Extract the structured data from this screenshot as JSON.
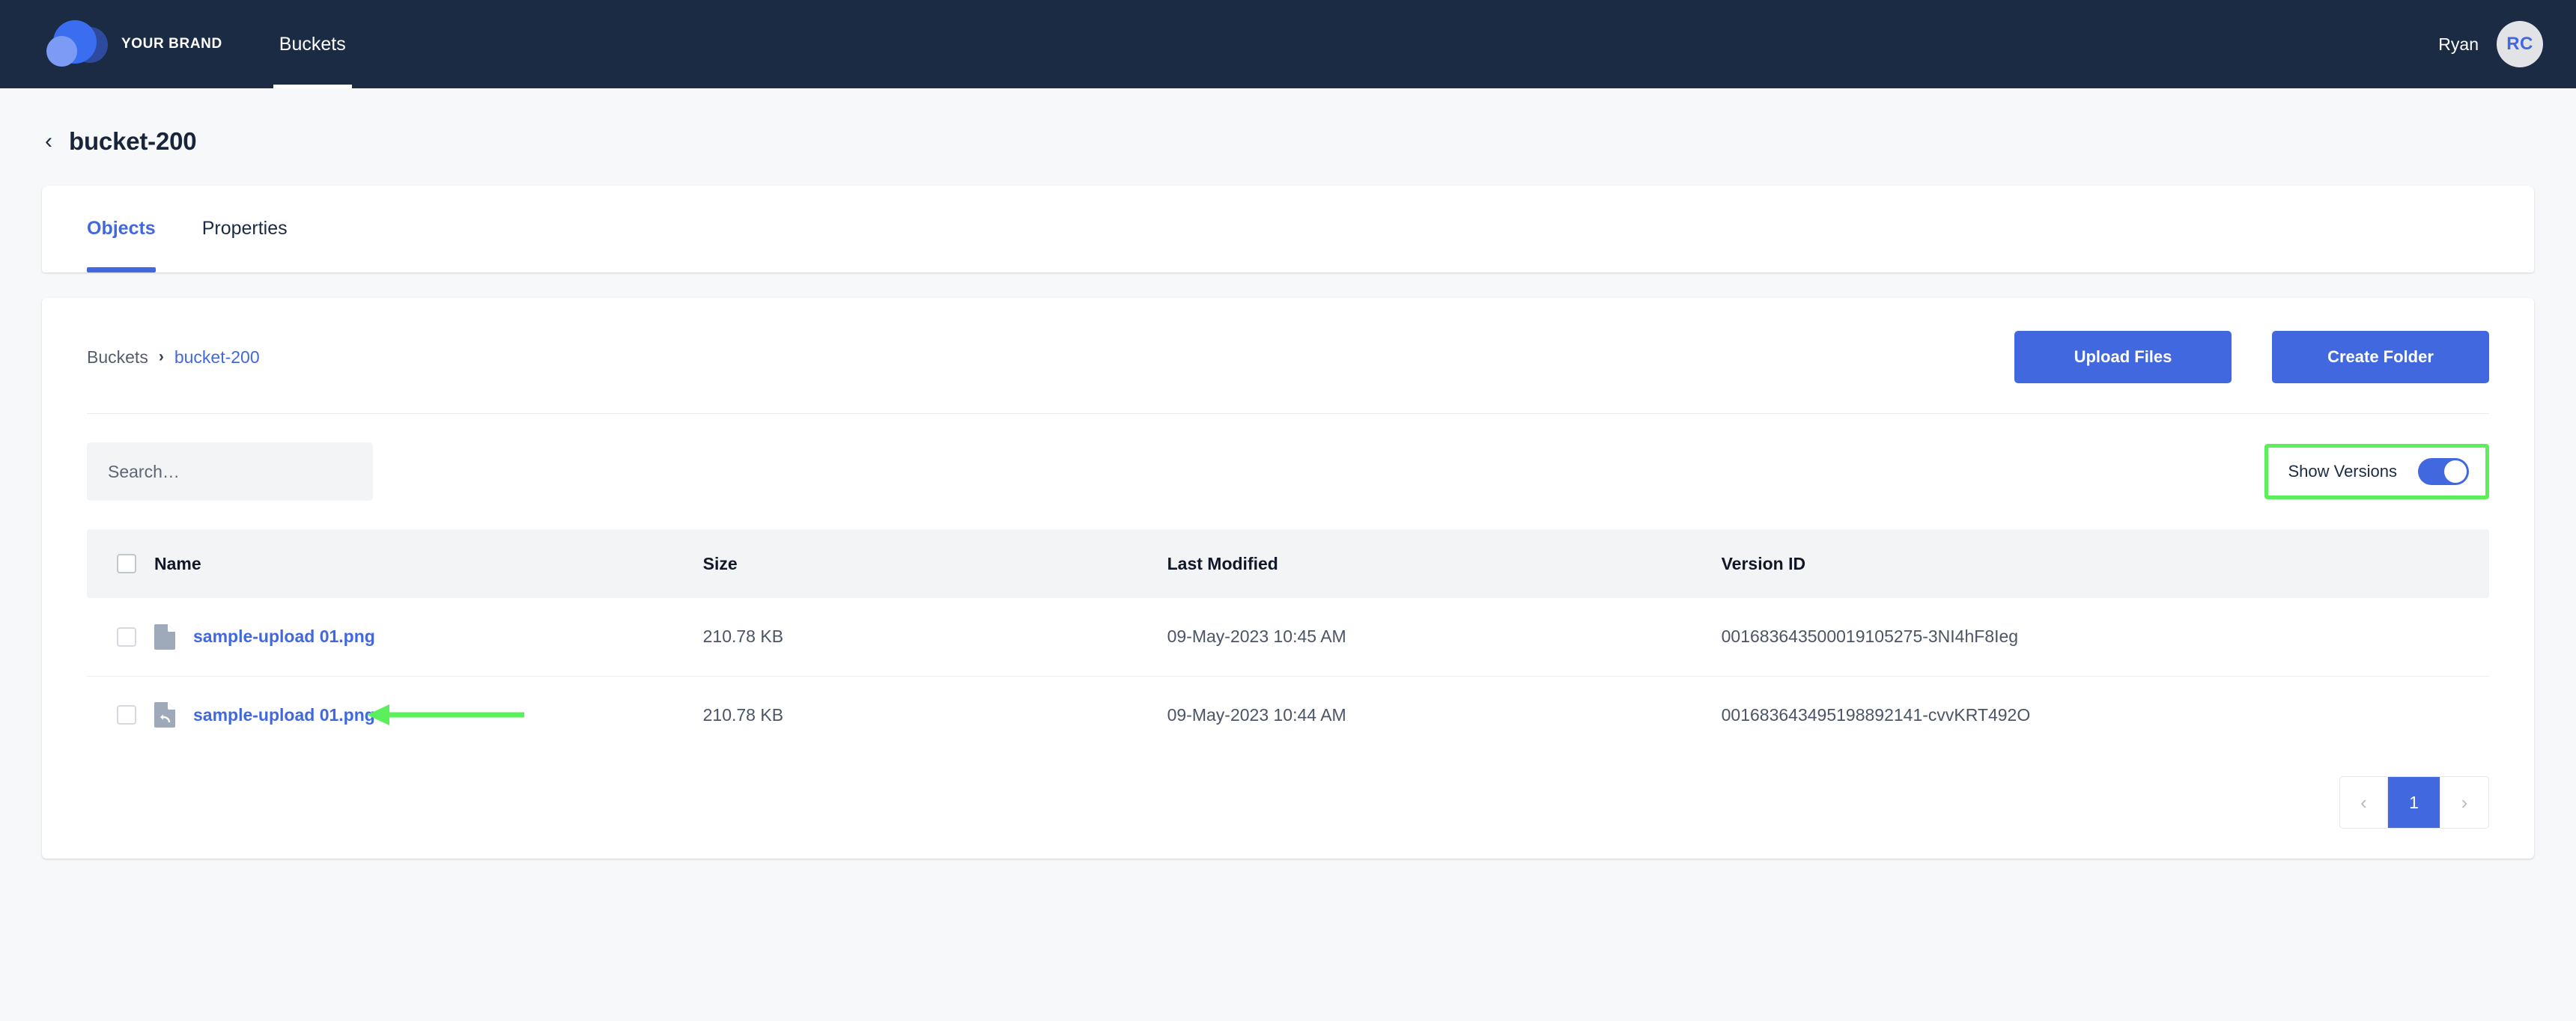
{
  "topbar": {
    "brand_name": "YOUR BRAND",
    "logo_icon": "cloud-logo-icon",
    "nav_items": [
      {
        "label": "Buckets",
        "active": true
      }
    ],
    "user_name": "Ryan",
    "avatar_initials": "RC"
  },
  "page": {
    "back_icon": "chevron-left-icon",
    "title": "bucket-200"
  },
  "tabs": [
    {
      "label": "Objects",
      "active": true
    },
    {
      "label": "Properties",
      "active": false
    }
  ],
  "panel": {
    "breadcrumb": {
      "root": "Buckets",
      "separator": "›",
      "current": "bucket-200"
    },
    "actions": {
      "upload_label": "Upload Files",
      "create_folder_label": "Create Folder"
    },
    "search": {
      "placeholder": "Search…",
      "value": ""
    },
    "show_versions": {
      "label": "Show Versions",
      "enabled": true,
      "highlight_color": "#5bf05b"
    }
  },
  "table": {
    "columns": [
      "Name",
      "Size",
      "Last Modified",
      "Version ID"
    ],
    "rows": [
      {
        "icon": "file-icon",
        "name": "sample-upload 01.png",
        "size": "210.78 KB",
        "last_modified": "09-May-2023 10:45 AM",
        "version_id": "001683643500019105275-3NI4hF8Ieg",
        "annotated": false
      },
      {
        "icon": "file-version-icon",
        "name": "sample-upload 01.png",
        "size": "210.78 KB",
        "last_modified": "09-May-2023 10:44 AM",
        "version_id": "001683643495198892141-cvvKRT492O",
        "annotated": true
      }
    ]
  },
  "pagination": {
    "prev_icon": "chevron-left-icon",
    "next_icon": "chevron-right-icon",
    "pages": [
      "1"
    ],
    "current_page": "1"
  },
  "colors": {
    "accent": "#4268e0",
    "topbar_bg": "#1b2b44",
    "annotation": "#5bf05b",
    "page_bg": "#f7f8fa"
  }
}
